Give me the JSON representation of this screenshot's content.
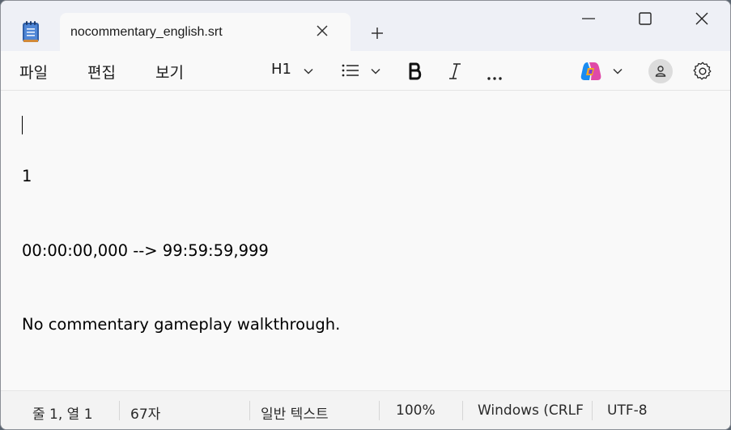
{
  "tab": {
    "title": "nocommentary_english.srt"
  },
  "menu": {
    "file": "파일",
    "edit": "편집",
    "view": "보기"
  },
  "toolbar": {
    "heading": "H1"
  },
  "editor": {
    "lines": [
      "1",
      "00:00:00,000 --> 99:59:59,999",
      "No commentary gameplay walkthrough."
    ]
  },
  "status": {
    "position": "줄 1, 열 1",
    "chars": "67자",
    "format": "일반 텍스트",
    "zoom": "100%",
    "line_ending": "Windows (CRLF",
    "encoding": "UTF-8"
  },
  "icons": {
    "app": "notepad-icon",
    "list": "bulleted-list-icon",
    "bold": "bold-icon",
    "italic": "italic-icon",
    "more": "more-icon",
    "copilot": "copilot-icon",
    "account": "account-icon",
    "settings": "gear-icon"
  }
}
